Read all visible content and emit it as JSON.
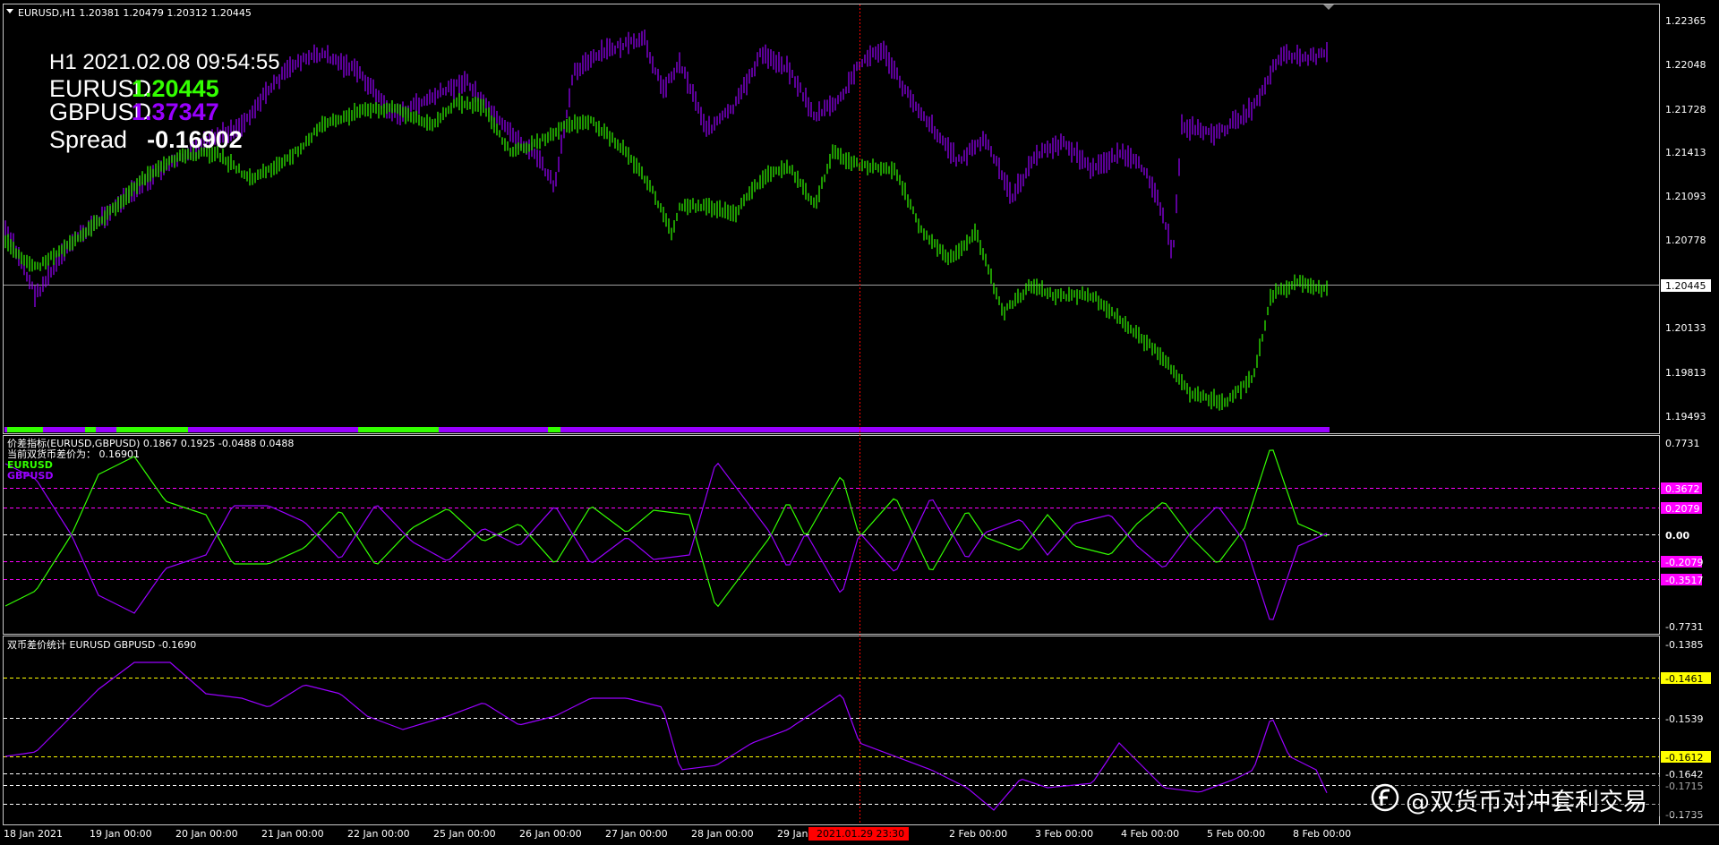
{
  "header": {
    "symbol_line": "EURUSD,H1  1.20381 1.20479 1.20312 1.20445"
  },
  "overlay": {
    "time_line": "H1  2021.02.08 09:54:55",
    "pair1_label": "EURUSD",
    "pair1_value": "1.20445",
    "pair2_label": "GBPUSD",
    "pair2_value": "1.37347",
    "spread_label": "Spread",
    "spread_value": "-0.16902"
  },
  "main_axis": {
    "labels": [
      "1.22365",
      "1.22048",
      "1.21728",
      "1.21413",
      "1.21093",
      "1.20778",
      "1.20445",
      "1.20133",
      "1.19813",
      "1.19493"
    ],
    "current_price": "1.20445"
  },
  "indicator1": {
    "title": "价差指标(EURUSD,GBPUSD) 0.1867 0.1925 -0.0488 0.0488",
    "current_line": "当前双货币差价为： 0.16901",
    "legend": [
      "EURUSD",
      "GBPUSD"
    ],
    "axis_labels": [
      "0.7731",
      "0.3672",
      "0.2079",
      "0.00",
      "-0.2079",
      "-0.3517",
      "-0.7731"
    ]
  },
  "indicator2": {
    "title": "双币差价统计 EURUSD GBPUSD -0.1690",
    "axis_labels": [
      "-0.1385",
      "-0.1461",
      "-0.1539",
      "-0.1612",
      "-0.1642",
      "-0.1715",
      "-0.1735"
    ]
  },
  "time_axis": {
    "labels": [
      "18 Jan 2021",
      "19 Jan 00:00",
      "20 Jan 00:00",
      "21 Jan 00:00",
      "22 Jan 00:00",
      "25 Jan 00:00",
      "26 Jan 00:00",
      "27 Jan 00:00",
      "28 Jan 00:00",
      "29 Jan",
      "2 Feb 00:00",
      "3 Feb 00:00",
      "4 Feb 00:00",
      "5 Feb 00:00",
      "8 Feb 00:00"
    ],
    "crosshair_label": "2021.01.29 23:30"
  },
  "watermark": {
    "text": "@双货币对冲套利交易"
  },
  "colors": {
    "eurusd": "#33ff00",
    "gbpusd": "#9900ff",
    "grid_magenta": "#ff00ff",
    "grid_yellow": "#ffff00",
    "crosshair": "#ff0000",
    "background": "#000000"
  }
}
